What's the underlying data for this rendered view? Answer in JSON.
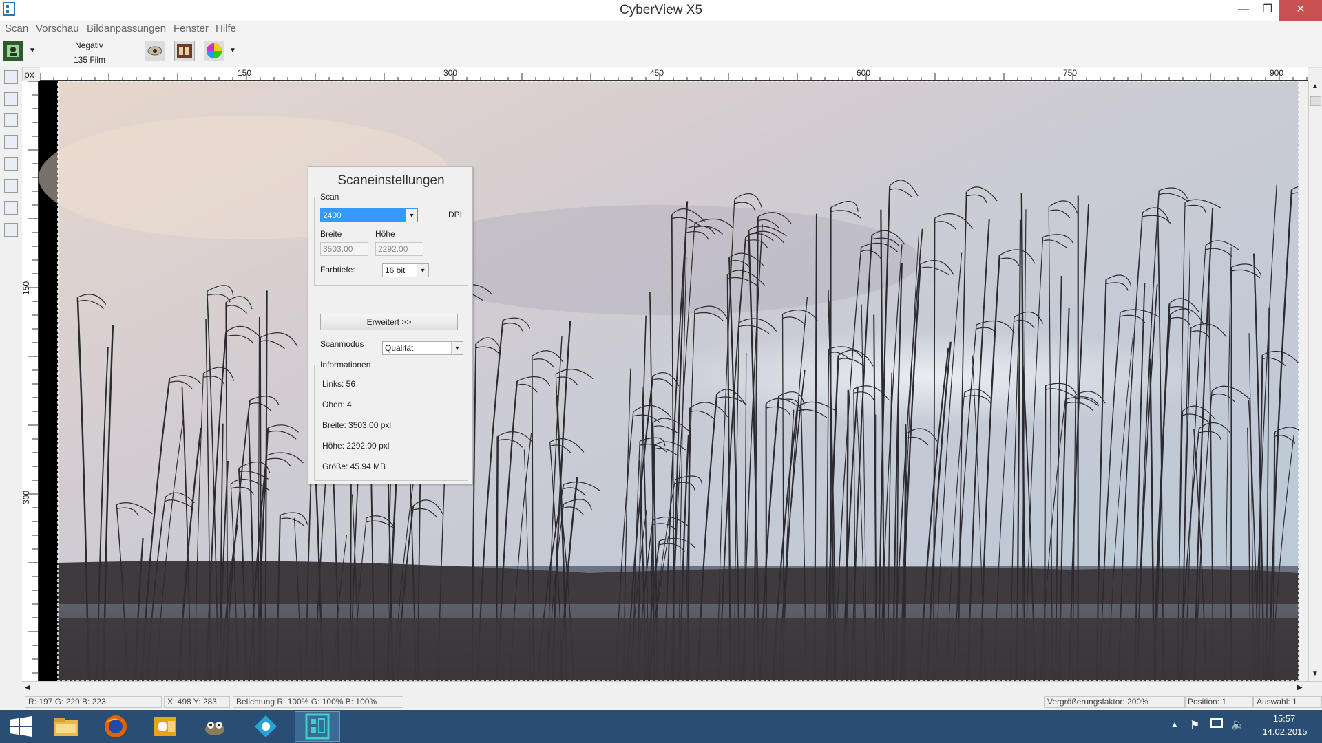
{
  "window": {
    "title": "CyberView X5"
  },
  "menu": [
    "Scan",
    "Vorschau",
    "Bildanpassungen",
    "Fenster",
    "Hilfe"
  ],
  "toolbar": {
    "film_type": "Negativ",
    "film_format": "135 Film"
  },
  "ruler": {
    "unit": "px",
    "top_ticks": [
      "150",
      "300",
      "450",
      "600",
      "750",
      "900"
    ],
    "left_ticks": [
      "150",
      "300"
    ]
  },
  "dialog": {
    "title": "Scaneinstellungen",
    "scan_group": "Scan",
    "dpi_value": "2400",
    "dpi_unit": "DPI",
    "width_label": "Breite",
    "height_label": "Höhe",
    "width_value": "3503.00",
    "height_value": "2292.00",
    "depth_label": "Farbtiefe:",
    "depth_value": "16 bit",
    "advanced_button": "Erweitert >>",
    "mode_label": "Scanmodus",
    "mode_value": "Qualität",
    "info_group": "Informationen",
    "info": [
      "Links: 56",
      "Oben: 4",
      "Breite: 3503.00 pxl",
      "Höhe: 2292.00 pxl",
      "Größe: 45.94 MB"
    ]
  },
  "status": {
    "rgb": "R: 197 G: 229 B: 223",
    "xy": "X: 498 Y: 283",
    "exposure": "Belichtung R: 100% G: 100% B: 100%",
    "zoom": "Vergrößerungsfaktor: 200%",
    "position": "Position: 1",
    "selection": "Auswahl: 1"
  },
  "taskbar": {
    "time": "15:57",
    "date": "14.02.2015"
  },
  "colors": {
    "title_close": "#c75050",
    "taskbar": "#2a4d73",
    "dpi_selected": "#3399ff"
  },
  "icons": [
    "app-icon",
    "minimize-icon",
    "maximize-icon",
    "close-icon",
    "scanner-icon",
    "eye-icon",
    "film-strip-icon",
    "color-wheel-icon",
    "windows-start-icon",
    "explorer-icon",
    "firefox-icon",
    "outlook-icon",
    "gimp-icon",
    "app-task-icon",
    "cyberview-icon"
  ]
}
